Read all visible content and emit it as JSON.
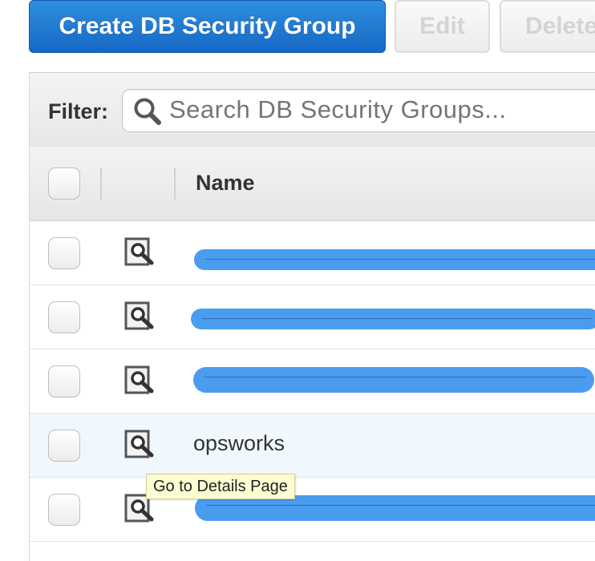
{
  "toolbar": {
    "create_label": "Create DB Security Group",
    "edit_label": "Edit",
    "delete_label": "Delete"
  },
  "filter": {
    "label": "Filter:",
    "placeholder": "Search DB Security Groups...",
    "icon": "magnifier-icon"
  },
  "table": {
    "columns": [
      "",
      "",
      "Name"
    ],
    "rows": [
      {
        "name": "",
        "redacted": true
      },
      {
        "name": "",
        "redacted": true
      },
      {
        "name": "",
        "redacted": true
      },
      {
        "name": "opsworks",
        "redacted": false,
        "hovered": true
      },
      {
        "name": "",
        "redacted": true
      }
    ],
    "row_icon": "view-details-icon"
  },
  "tooltip": {
    "text": "Go to Details Page"
  },
  "colors": {
    "primary_button": "#1f7bd6",
    "redaction": "#4a9cef",
    "row_hover": "#f1f8fd",
    "tooltip_bg": "#fefcd3"
  }
}
